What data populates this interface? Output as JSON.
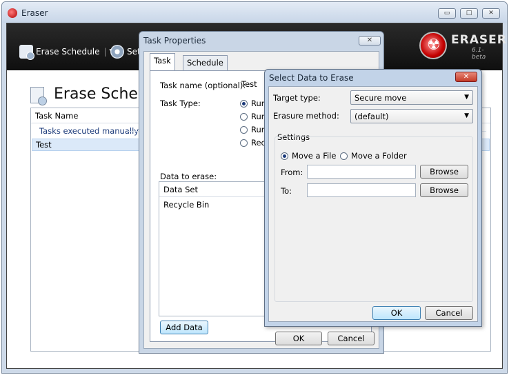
{
  "main_window": {
    "title": "Eraser",
    "controls": {
      "minimize": "▭",
      "maximize": "□",
      "close": "✕"
    }
  },
  "toolbar": {
    "erase_schedule_label": "Erase Schedule",
    "settings_label": "Sett",
    "brand_name": "ERASER",
    "brand_version": "6.1-beta"
  },
  "page": {
    "title": "Erase Schedu",
    "list_header": "Task Name",
    "group_label": "Tasks executed manually",
    "rows": [
      "Test"
    ]
  },
  "task_dialog": {
    "title": "Task Properties",
    "close": "✕",
    "tabs": [
      "Task",
      "Schedule"
    ],
    "task_name_label": "Task name (optional):",
    "task_name_value": "Test",
    "task_type_label": "Task Type:",
    "task_type_options": [
      "Run",
      "Run",
      "Run",
      "Recu"
    ],
    "data_to_erase_label": "Data to erase:",
    "data_list_header": "Data Set",
    "data_list_items": [
      "Recycle Bin"
    ],
    "add_data_label": "Add Data",
    "ok_label": "OK",
    "cancel_label": "Cancel"
  },
  "select_dialog": {
    "title": "Select Data to Erase",
    "close": "✕",
    "target_type_label": "Target type:",
    "target_type_value": "Secure move",
    "erasure_method_label": "Erasure method:",
    "erasure_method_value": "(default)",
    "settings_label": "Settings",
    "move_file_label": "Move a File",
    "move_folder_label": "Move a Folder",
    "from_label": "From:",
    "to_label": "To:",
    "browse_label": "Browse",
    "ok_label": "OK",
    "cancel_label": "Cancel"
  }
}
